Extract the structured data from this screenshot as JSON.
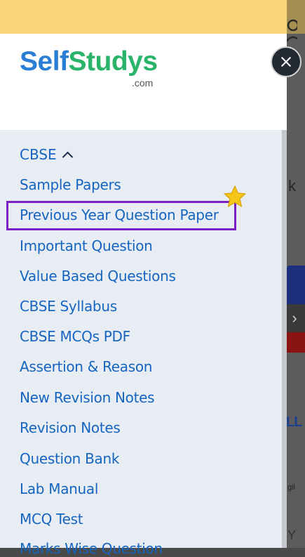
{
  "brand": {
    "name_part1": "Self",
    "name_part2": "Studys",
    "domain": ".com"
  },
  "menu": {
    "section_title": "CBSE",
    "items": [
      "Sample Papers",
      "Previous Year Question Paper",
      "Important Question",
      "Value Based Questions",
      "CBSE Syllabus",
      "CBSE MCQs PDF",
      "Assertion & Reason",
      "New Revision Notes",
      "Revision Notes",
      "Question Bank",
      "Lab Manual",
      "MCQ Test",
      "Marks Wise Question"
    ],
    "highlighted_item": "Previous Year Question Paper"
  },
  "background": {
    "partial_k": "k",
    "partial_ll": "LL",
    "partial_gil": "gil",
    "partial_y": "Y"
  },
  "colors": {
    "link": "#1565c0",
    "highlight_border": "#7b1fc4",
    "top_strip": "#f9d67a",
    "drawer_bg": "#e8edf4"
  }
}
